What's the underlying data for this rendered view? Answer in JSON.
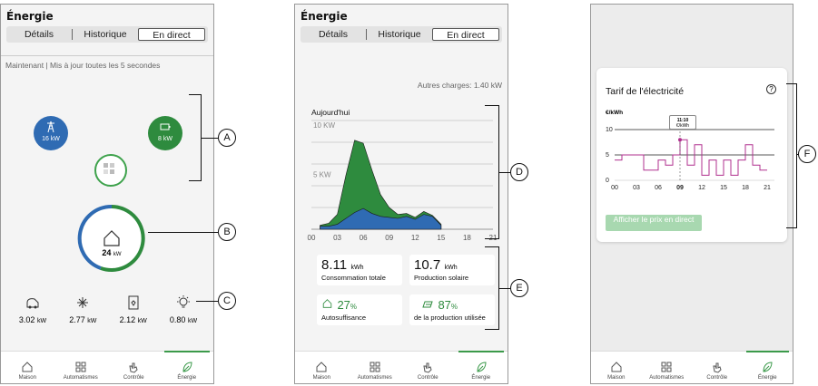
{
  "screens": [
    {
      "title": "Énergie",
      "tabs": [
        "Détails",
        "Historique",
        "En direct"
      ],
      "active_tab": "En direct",
      "status_line": "Maintenant | Mis à jour toutes les 5 secondes",
      "sources": {
        "grid": "16 kW",
        "battery": "8 kW"
      },
      "home": {
        "value": "24",
        "unit": "kW"
      },
      "consumers": [
        {
          "icon": "ev-charger-icon",
          "value": "3.02",
          "unit": "kW"
        },
        {
          "icon": "air-conditioner-icon",
          "value": "2.77",
          "unit": "kW"
        },
        {
          "icon": "water-heater-icon",
          "value": "2.12",
          "unit": "kW"
        },
        {
          "icon": "light-bulb-icon",
          "value": "0.80",
          "unit": "kW"
        }
      ]
    },
    {
      "title": "Énergie",
      "tabs": [
        "Détails",
        "Historique",
        "En direct"
      ],
      "active_tab": "En direct",
      "other_charges": "Autres charges: 1.40 kW",
      "today_label": "Aujourd'hui",
      "stats": [
        {
          "value": "8.11",
          "unit": "kWh",
          "label": "Consommation totale"
        },
        {
          "value": "10.7",
          "unit": "kWh",
          "label": "Production solaire"
        },
        {
          "value": "27",
          "unit": "%",
          "label": "Autosuffisance",
          "color": "#2e8b3e"
        },
        {
          "value": "87",
          "unit": "%",
          "label": "de la production utilisée",
          "color": "#2e8b3e"
        }
      ]
    },
    {
      "tariff_title": "Tarif de l'électricité",
      "y_unit": "€/kWh",
      "tooltip_time": "11:10",
      "tooltip_unit": "€/kWh",
      "live_price_button": "Afficher le prix en direct"
    }
  ],
  "nav": [
    {
      "label": "Maison",
      "icon": "home-icon"
    },
    {
      "label": "Automatismes",
      "icon": "grid-icon"
    },
    {
      "label": "Contrôle",
      "icon": "hand-icon"
    },
    {
      "label": "Énergie",
      "icon": "leaf-icon"
    }
  ],
  "callouts": [
    "A",
    "B",
    "C",
    "D",
    "E",
    "F"
  ],
  "colors": {
    "grid_blue": "#2f6bb3",
    "green": "#2e8b3e",
    "tariff_magenta": "#b0308f"
  },
  "chart_data": [
    {
      "type": "area",
      "title": "",
      "x": [
        "00",
        "03",
        "06",
        "09",
        "12",
        "15",
        "18",
        "21"
      ],
      "y_tick_labels": [
        "5 KW",
        "10 KW"
      ],
      "series": [
        {
          "x": [
            1,
            2,
            3,
            4,
            5,
            6,
            7,
            8,
            9,
            10,
            11,
            12,
            13,
            14,
            15
          ],
          "values": [
            0.4,
            0.6,
            1.5,
            5.5,
            9.0,
            8.7,
            6.0,
            3.5,
            2.2,
            1.5,
            1.6,
            1.2,
            1.8,
            1.4,
            0.5
          ]
        },
        {
          "x": [
            1,
            2,
            3,
            4,
            5,
            6,
            7,
            8,
            9,
            10,
            11,
            12,
            13,
            14,
            15
          ],
          "values": [
            0.3,
            0.3,
            0.5,
            1.1,
            1.7,
            2.1,
            1.6,
            1.3,
            1.2,
            1.1,
            1.3,
            1.0,
            1.5,
            1.3,
            0.4
          ]
        }
      ],
      "xlim": [
        0,
        21
      ],
      "ylim": [
        0,
        11
      ]
    },
    {
      "type": "line",
      "title": "Tarif de l'électricité",
      "x_ticks": [
        "00",
        "03",
        "06",
        "09",
        "12",
        "15",
        "18",
        "21"
      ],
      "y_ticks": [
        "0",
        "5",
        "10"
      ],
      "ylabel": "€/kWh",
      "series": [
        {
          "x": [
            0,
            1,
            1,
            4,
            4,
            6,
            6,
            7,
            7,
            8,
            8,
            9,
            9,
            10,
            10,
            11,
            11,
            12,
            12,
            13,
            13,
            14,
            14,
            15,
            15,
            16,
            16,
            17,
            17,
            18,
            18,
            19,
            19,
            20,
            20,
            21
          ],
          "values": [
            4,
            4,
            5,
            5,
            2,
            2,
            4,
            4,
            3,
            3,
            5,
            5,
            8,
            8,
            3,
            3,
            7,
            7,
            1,
            1,
            4,
            4,
            1,
            1,
            4,
            4,
            1,
            1,
            4,
            4,
            7,
            7,
            3,
            3,
            2,
            2
          ]
        }
      ],
      "marker_x": 9,
      "marker_y": 8,
      "xlim": [
        0,
        22
      ],
      "ylim": [
        0,
        10
      ]
    }
  ]
}
